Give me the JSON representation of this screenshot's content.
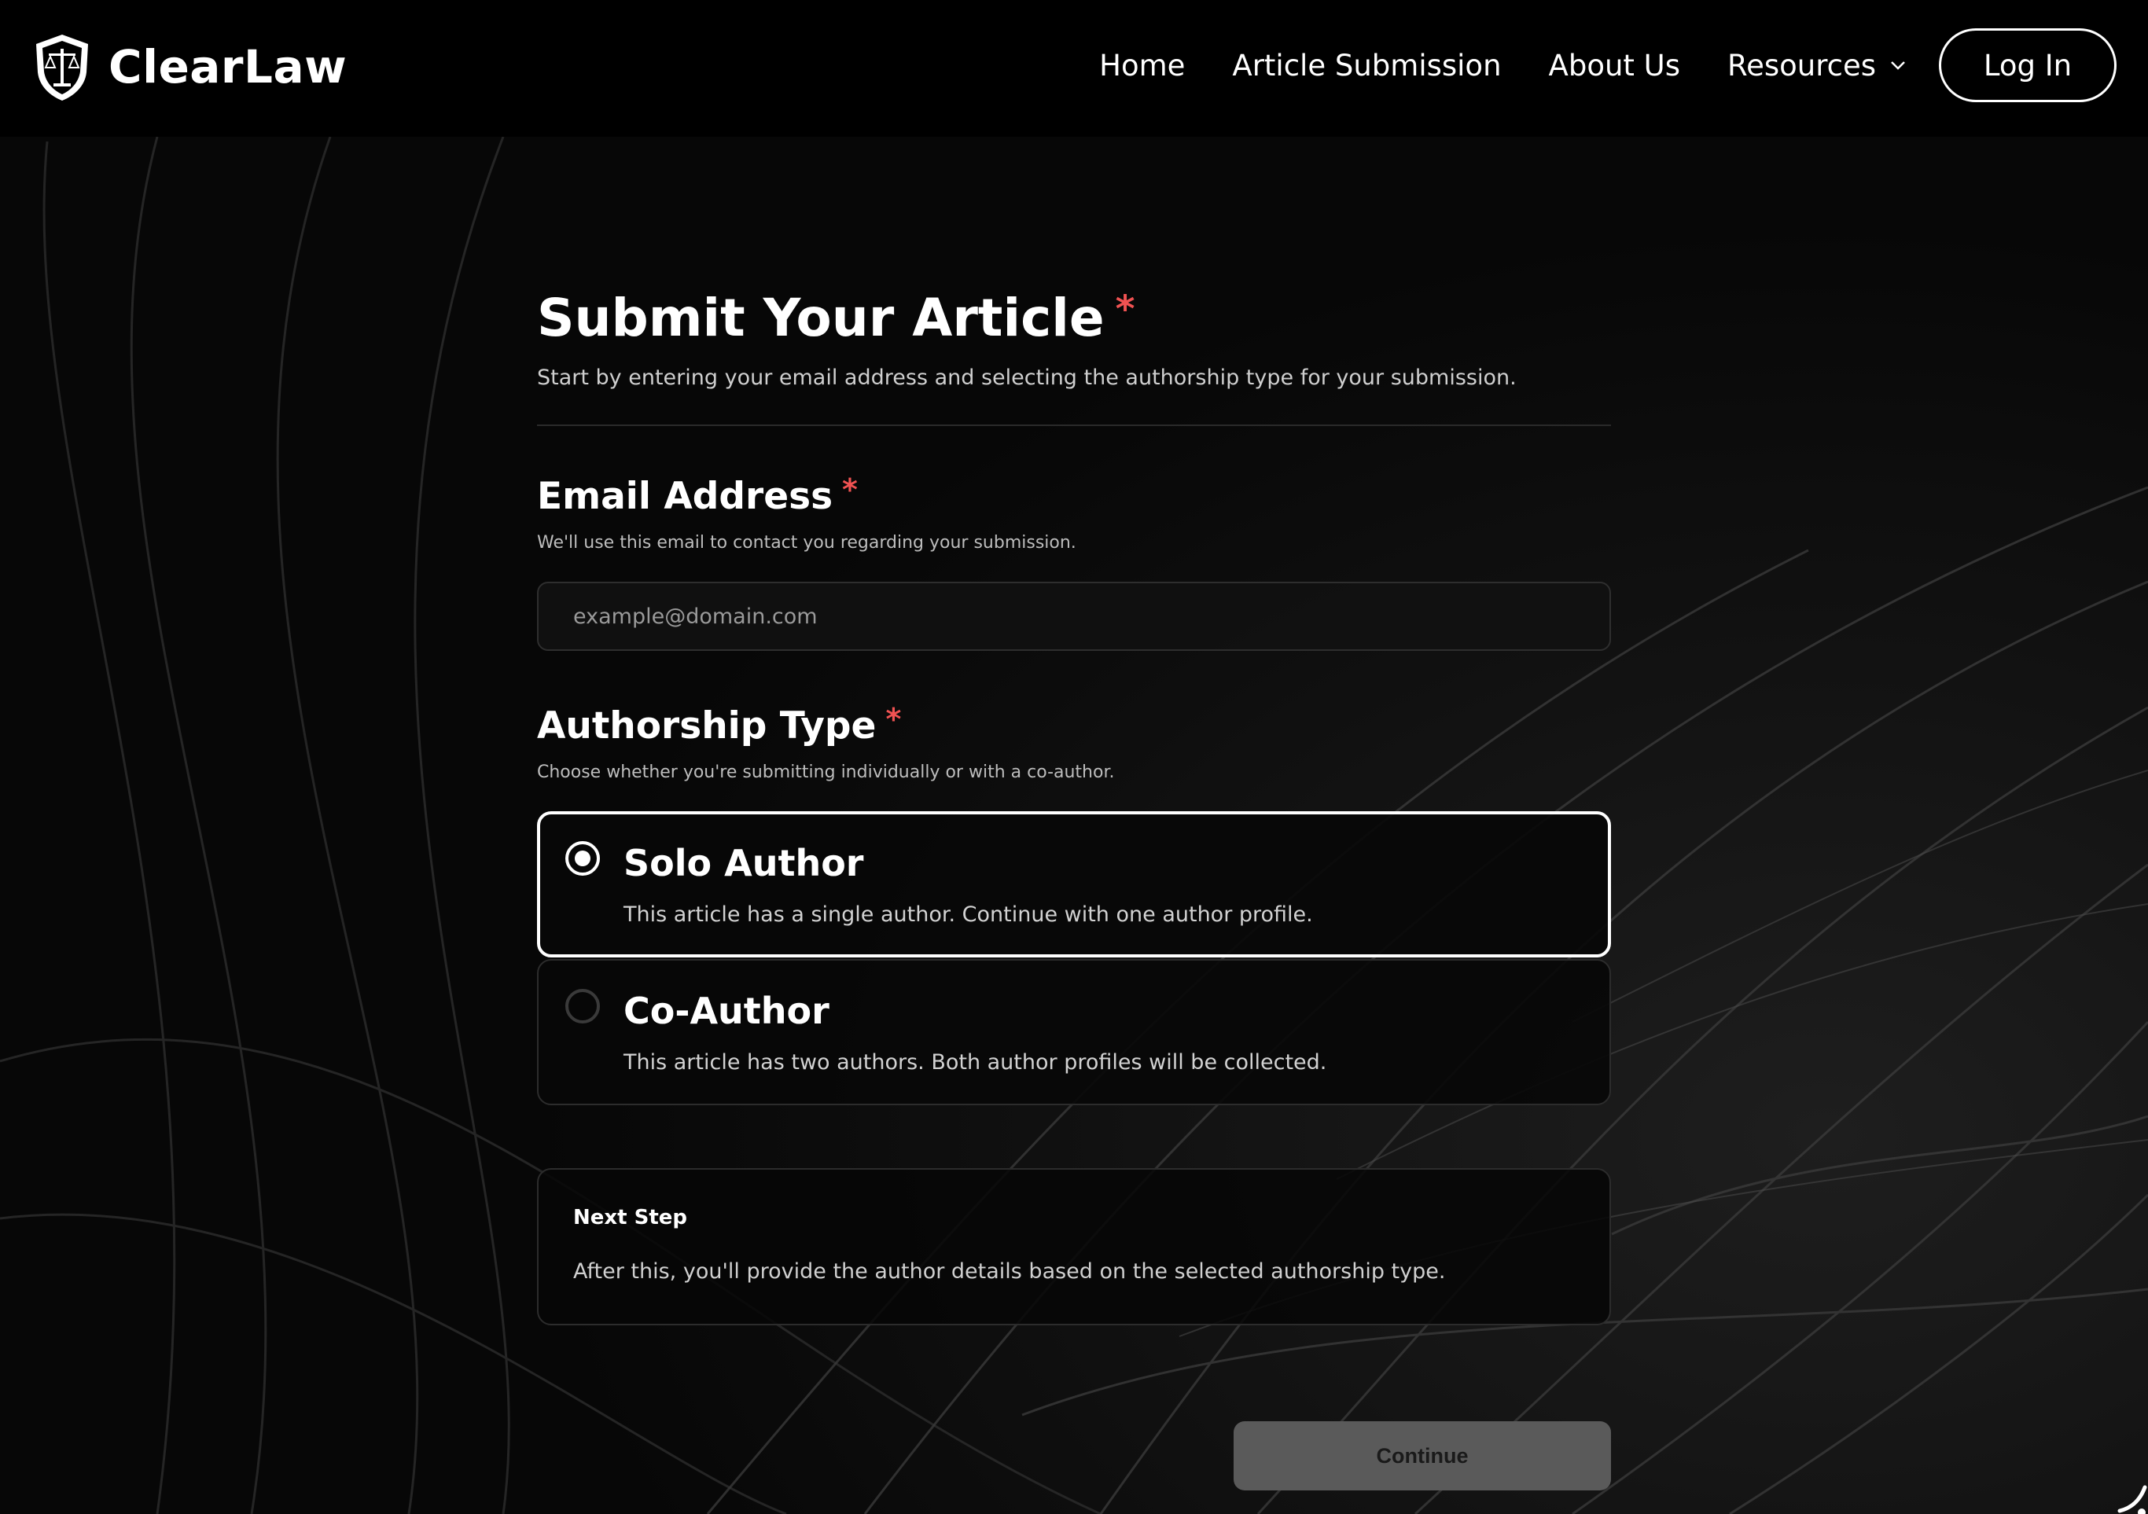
{
  "header": {
    "brand_name": "ClearLaw",
    "logo_icon": "scales-shield-icon",
    "nav": [
      {
        "label": "Home"
      },
      {
        "label": "Article Submission"
      },
      {
        "label": "About Us"
      },
      {
        "label": "Resources",
        "has_dropdown": true
      }
    ],
    "login_label": "Log In"
  },
  "form": {
    "title": "Submit Your Article",
    "required_mark": "*",
    "subtitle": "Start by entering your email address and selecting the authorship type for your submission.",
    "email": {
      "label": "Email Address",
      "help": "We'll use this email to contact you regarding your submission.",
      "placeholder": "example@domain.com",
      "value": ""
    },
    "authorship": {
      "label": "Authorship Type",
      "help": "Choose whether you're submitting individually or with a co-author.",
      "options": [
        {
          "title": "Solo Author",
          "description": "This article has a single author. Continue with one author profile.",
          "selected": true
        },
        {
          "title": "Co-Author",
          "description": "This article has two authors. Both author profiles will be collected.",
          "selected": false
        }
      ]
    },
    "next_step": {
      "title": "Next Step",
      "text": "After this, you'll provide the author details based on the selected authorship type."
    },
    "continue_label": "Continue"
  },
  "colors": {
    "background": "#070707",
    "header": "#000000",
    "required": "#f05252",
    "button_disabled": "#5a5a5a"
  }
}
